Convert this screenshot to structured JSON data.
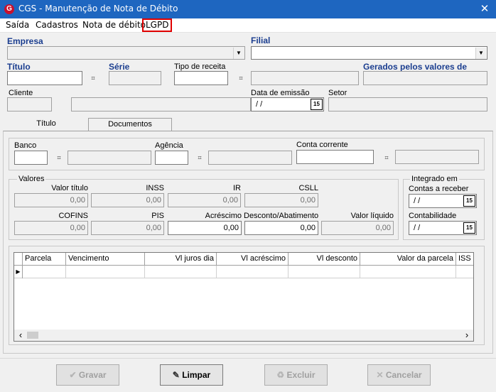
{
  "window": {
    "title": "CGS - Manutenção de Nota de Débito",
    "close_glyph": "✕",
    "app_icon_letter": "G"
  },
  "menu": {
    "items": [
      "Saída",
      "Cadastros",
      "Nota de débito",
      "LGPD"
    ]
  },
  "header": {
    "empresa_label": "Empresa",
    "filial_label": "Filial",
    "titulo_label": "Título",
    "serie_label": "Série",
    "tipo_receita_label": "Tipo de receita",
    "gerados_label": "Gerados pelos valores de",
    "cliente_label": "Cliente",
    "data_emissao_label": "Data de emissão",
    "data_emissao_value": "/ /",
    "setor_label": "Setor"
  },
  "tabs": [
    "Título",
    "Documentos"
  ],
  "banco": {
    "banco_label": "Banco",
    "agencia_label": "Agência",
    "conta_label": "Conta corrente"
  },
  "valores": {
    "group_title": "Valores",
    "labels": [
      "Valor título",
      "INSS",
      "IR",
      "CSLL",
      "COFINS",
      "PIS",
      "Acréscimo",
      "Desconto/Abatimento",
      "Valor líquido"
    ],
    "values": [
      "0,00",
      "0,00",
      "0,00",
      "0,00",
      "0,00",
      "0,00",
      "0,00",
      "0,00",
      "0,00"
    ]
  },
  "integrado": {
    "group_title": "Integrado em",
    "contas_label": "Contas a receber",
    "contas_value": "/ /",
    "contabilidade_label": "Contabilidade",
    "contabilidade_value": "/ /"
  },
  "grid": {
    "columns": [
      "Parcela",
      "Vencimento",
      "Vl juros dia",
      "Vl acréscimo",
      "Vl desconto",
      "Valor da parcela",
      "ISS"
    ]
  },
  "buttons": {
    "gravar": "Gravar",
    "limpar": "Limpar",
    "excluir": "Excluir",
    "cancelar": "Cancelar"
  },
  "icons": {
    "calendar": "15",
    "binoculars": "⌗",
    "dropdown": "▼",
    "scroll_left": "‹",
    "scroll_right": "›",
    "row_pointer": "▶"
  },
  "colors": {
    "titlebar": "#1e66c0",
    "label_blue": "#1a3d8f",
    "highlight_red": "#e00000"
  }
}
